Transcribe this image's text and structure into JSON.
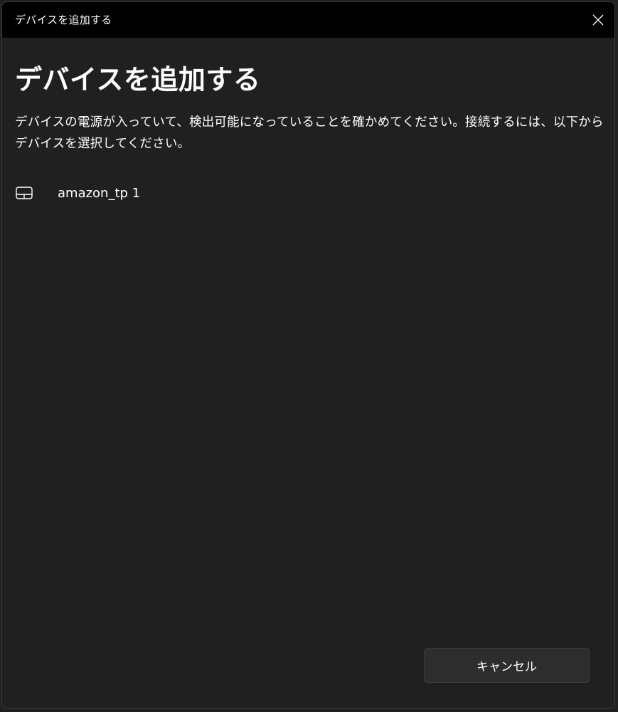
{
  "window": {
    "title": "デバイスを追加する"
  },
  "main": {
    "heading": "デバイスを追加する",
    "description": "デバイスの電源が入っていて、検出可能になっていることを確かめてください。接続するには、以下からデバイスを選択してください。",
    "devices": [
      {
        "name": "amazon_tp 1",
        "icon": "touchpad-icon"
      }
    ]
  },
  "footer": {
    "cancel_label": "キャンセル"
  },
  "colors": {
    "titlebar": "#000000",
    "background": "#202020",
    "button": "#2d2d2d",
    "accent": "#2f7fd8"
  }
}
